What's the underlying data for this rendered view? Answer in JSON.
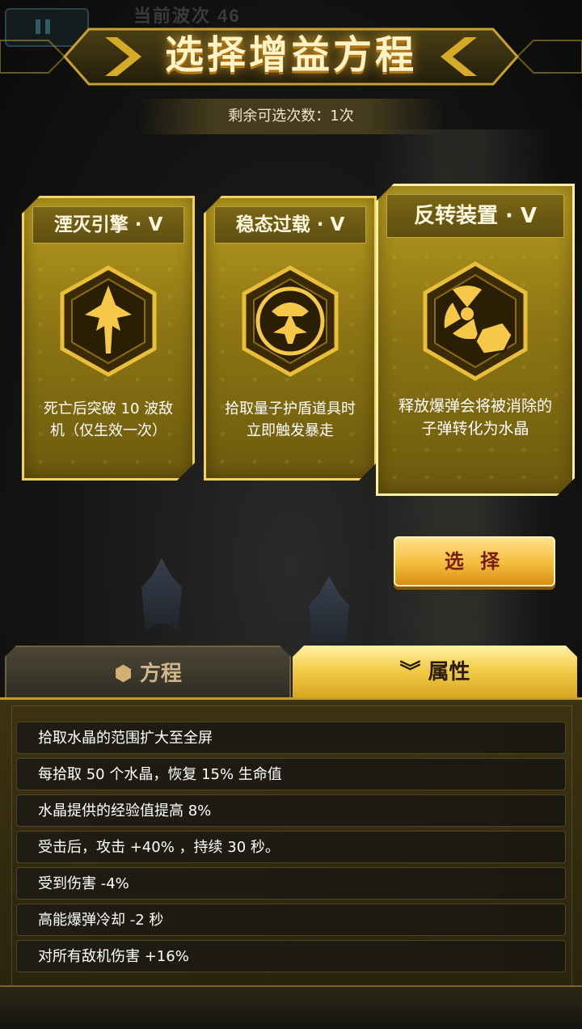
{
  "header": {
    "wave_text": "当前波次 46",
    "title": "选择增益方程",
    "remaining": "剩余可选次数：1次"
  },
  "cards": [
    {
      "title": "湮灭引擎 · V",
      "desc": "死亡后突破 10 波敌机（仅生效一次）",
      "icon": "jet-arrow-icon"
    },
    {
      "title": "稳态过载 · V",
      "desc": "拾取量子护盾道具时立即触发暴走",
      "icon": "shield-ship-icon"
    },
    {
      "title": "反转装置 · V",
      "desc": "释放爆弹会将被消除的子弹转化为水晶",
      "icon": "radiation-crystal-icon"
    }
  ],
  "selected_card": 2,
  "select_button": "选 择",
  "tabs": [
    {
      "label": "方程",
      "icon": "hexagon-icon",
      "active": false
    },
    {
      "label": "属性",
      "icon": "double-chevron-down-icon",
      "active": true
    }
  ],
  "attributes": [
    "拾取水晶的范围扩大至全屏",
    "每拾取 50 个水晶，恢复 15% 生命值",
    "水晶提供的经验值提高 8%",
    "受击后，攻击 +40% ，持续 30 秒。",
    "受到伤害 -4%",
    "高能爆弹冷却 -2 秒",
    "对所有敌机伤害 +16%"
  ],
  "colors": {
    "accent_gold": "#f3d35b",
    "button_text": "#7a1f10",
    "panel_bg": "#3d3312"
  }
}
